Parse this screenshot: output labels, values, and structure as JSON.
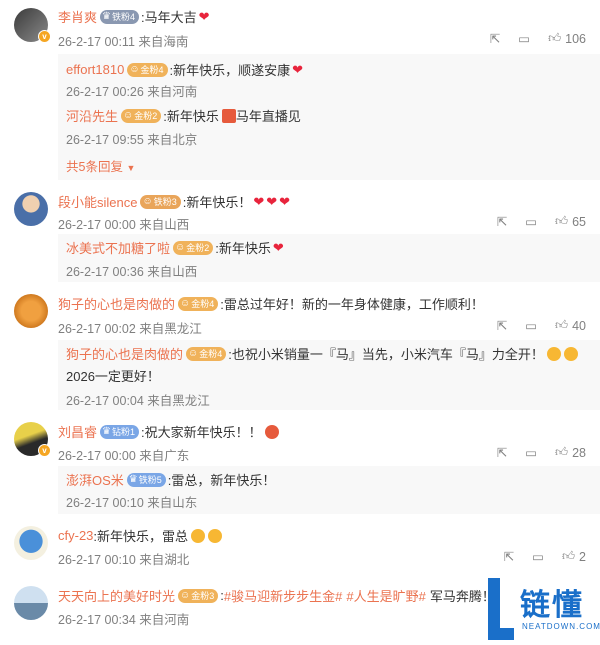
{
  "comments": [
    {
      "user": "李肖爽",
      "badge": "铁粉4",
      "text": ":马年大吉",
      "meta": "26-2-17 00:11 来自海南",
      "likes": "106",
      "replies": [
        {
          "user": "effort1810",
          "badge": "金粉4",
          "text": ":新年快乐，顺遂安康",
          "meta": "26-2-17 00:26 来自河南"
        },
        {
          "user": "河沿先生",
          "badge": "金粉2",
          "text": ":新年快乐",
          "text2": "马年直播见",
          "meta": "26-2-17 09:55 来自北京"
        }
      ],
      "more": "共5条回复"
    },
    {
      "user": "段小能silence",
      "badge": "铁粉3",
      "text": ":新年快乐！",
      "meta": "26-2-17 00:00 来自山西",
      "likes": "65",
      "replies": [
        {
          "user": "冰美式不加糖了啦",
          "badge": "金粉2",
          "text": ":新年快乐",
          "meta": "26-2-17 00:36 来自山西"
        }
      ]
    },
    {
      "user": "狗子的心也是肉做的",
      "badge": "金粉4",
      "text": ":雷总过年好！新的一年身体健康，工作顺利！",
      "meta": "26-2-17 00:02 来自黑龙江",
      "likes": "40",
      "replies": [
        {
          "user": "狗子的心也是肉做的",
          "badge": "金粉4",
          "text": ":也祝小米销量一『马』当先，小米汽车『马』力全开！",
          "text2": "2026一定更好！",
          "meta": "26-2-17 00:04 来自黑龙江"
        }
      ]
    },
    {
      "user": "刘昌睿",
      "badge": "钻粉1",
      "text": ":祝大家新年快乐！！",
      "meta": "26-2-17 00:00 来自广东",
      "likes": "28",
      "replies": [
        {
          "user": "澎湃OS米",
          "badge": "铁粉5",
          "text": ":雷总，新年快乐！",
          "meta": "26-2-17 00:10 来自山东"
        }
      ]
    },
    {
      "user": "cfy-23",
      "text": ":新年快乐，雷总",
      "meta": "26-2-17 00:10 来自湖北",
      "likes": "2"
    },
    {
      "user": "天天向上的美好时光",
      "badge": "金粉3",
      "text": ":",
      "tags": [
        "#骏马迎新步步生金#",
        "#人生是旷野#"
      ],
      "tail": "军马奔腾！",
      "meta": "26-2-17 00:34 来自河南"
    }
  ],
  "watermark": {
    "brand": "链懂",
    "site": "NEATDOWN.COM"
  },
  "colors": {
    "username": "#eb7350",
    "meta": "#808080",
    "accent": "#1a6fc9"
  }
}
